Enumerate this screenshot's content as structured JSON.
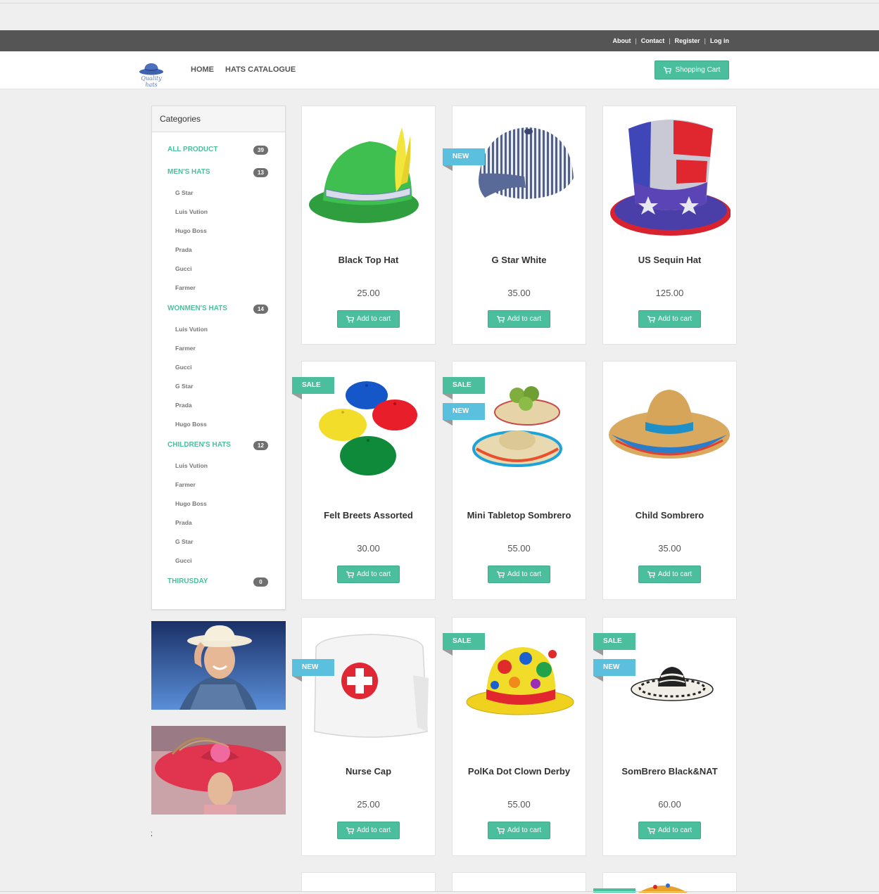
{
  "header": {
    "links": [
      "About",
      "Contact",
      "Register",
      "Log in"
    ],
    "logo_text": "Quality hats",
    "nav": [
      "HOME",
      "HATS CATALOGUE"
    ],
    "cart_label": "Shopping Cart"
  },
  "sidebar": {
    "title": "Categories",
    "categories": [
      {
        "name": "ALL PRODUCT",
        "count": "39",
        "subs": []
      },
      {
        "name": "MEN'S HATS",
        "count": "13",
        "subs": [
          "G Star",
          "Luis Vution",
          "Hugo Boss",
          "Prada",
          "Gucci",
          "Farmer"
        ]
      },
      {
        "name": "WONMEN'S HATS",
        "count": "14",
        "subs": [
          "Luis Vution",
          "Farmer",
          "Gucci",
          "G Star",
          "Prada",
          "Hugo Boss"
        ]
      },
      {
        "name": "CHILDREN'S HATS",
        "count": "12",
        "subs": [
          "Luis Vution",
          "Farmer",
          "Hugo Boss",
          "Prada",
          "G Star",
          "Gucci"
        ]
      },
      {
        "name": "THIRUSDAY",
        "count": "0",
        "subs": []
      }
    ],
    "stray_text": ";"
  },
  "products": [
    {
      "name": "Black Top Hat",
      "price": "25.00",
      "badges": [],
      "icon": "green-alpine-hat"
    },
    {
      "name": "G Star White",
      "price": "35.00",
      "badges": [
        "NEW"
      ],
      "icon": "striped-engineer-cap"
    },
    {
      "name": "US Sequin Hat",
      "price": "125.00",
      "badges": [],
      "icon": "sequin-top-hat"
    },
    {
      "name": "Felt Breets Assorted",
      "price": "30.00",
      "badges": [
        "SALE"
      ],
      "icon": "felt-berets"
    },
    {
      "name": "Mini Tabletop Sombrero",
      "price": "55.00",
      "badges": [
        "SALE",
        "NEW"
      ],
      "icon": "mini-sombreros"
    },
    {
      "name": "Child Sombrero",
      "price": "35.00",
      "badges": [],
      "icon": "straw-sombrero"
    },
    {
      "name": "Nurse Cap",
      "price": "25.00",
      "badges": [
        "NEW"
      ],
      "icon": "nurse-cap"
    },
    {
      "name": "PolKa Dot Clown Derby",
      "price": "55.00",
      "badges": [
        "SALE"
      ],
      "icon": "polka-dot-derby"
    },
    {
      "name": "SomBrero Black&NAT",
      "price": "60.00",
      "badges": [
        "SALE",
        "NEW"
      ],
      "icon": "black-white-sombrero"
    }
  ],
  "add_to_cart_label": "Add to cart",
  "colors": {
    "accent": "#4bbf9d",
    "new_badge": "#5bc0de",
    "topbar": "#555555",
    "background": "#efefef"
  }
}
